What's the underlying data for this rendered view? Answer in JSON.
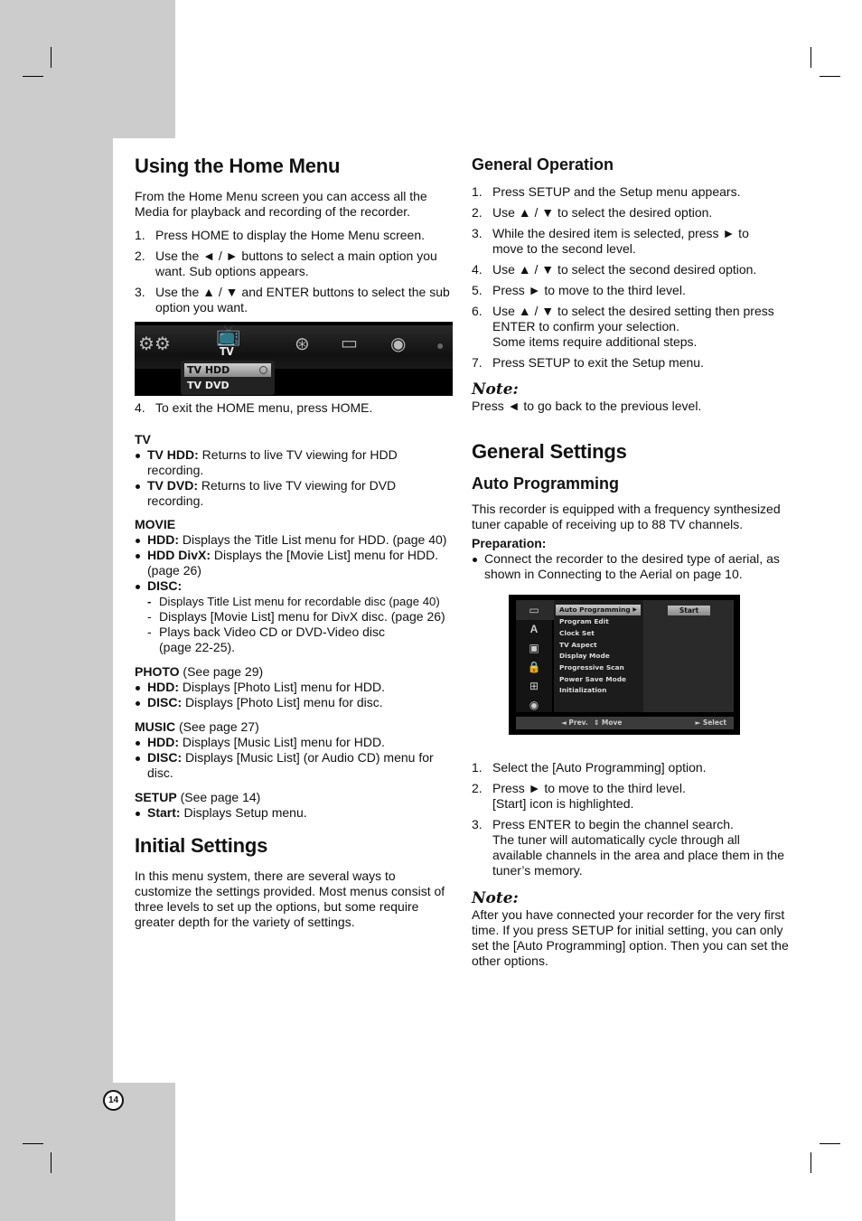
{
  "page_number": "14",
  "left_column": {
    "home_menu": {
      "title": "Using the Home Menu",
      "intro": "From the Home Menu screen you can access all the Media for playback and recording of the recorder.",
      "steps": [
        {
          "num": "1.",
          "text": "Press HOME to display the Home Menu screen."
        },
        {
          "num": "2.",
          "text": "Use the ◄ / ► buttons to select a main option you want. Sub options appears."
        },
        {
          "num": "3.",
          "text": "Use the ▲ / ▼ and ENTER buttons to select the sub option you want."
        }
      ],
      "screen": {
        "icons": [
          "setup-gears-icon",
          "tv-icon",
          "movie-reel-icon",
          "photo-icon",
          "music-icon",
          "clock-icon"
        ],
        "selected_label": "TV",
        "sub_items": [
          {
            "label": "TV HDD",
            "selected": true
          },
          {
            "label": "TV DVD",
            "selected": false
          }
        ]
      },
      "step4": {
        "num": "4.",
        "text": "To exit the HOME menu, press HOME."
      }
    },
    "categories": {
      "tv": {
        "heading": "TV",
        "items": [
          {
            "term": "TV HDD:",
            "text": " Returns to live TV viewing for HDD recording."
          },
          {
            "term": "TV DVD:",
            "text": " Returns to live TV viewing for DVD recording."
          }
        ]
      },
      "movie": {
        "heading": "MOVIE",
        "items": [
          {
            "term": "HDD:",
            "text": " Displays the Title List menu for HDD. (page 40)"
          },
          {
            "term": "HDD DivX:",
            "text": " Displays the [Movie List] menu for HDD. (page 26)"
          },
          {
            "term": "DISC:",
            "text": ""
          }
        ],
        "disc_sub": [
          "Displays Title List menu for recordable disc (page 40)",
          "Displays [Movie List] menu for DivX disc. (page 26)",
          "Plays back Video CD or DVD-Video disc (page 22-25)."
        ]
      },
      "photo": {
        "heading": "PHOTO",
        "ref": " (See page 29)",
        "items": [
          {
            "term": "HDD:",
            "text": " Displays [Photo List] menu for HDD."
          },
          {
            "term": "DISC:",
            "text": " Displays [Photo List] menu for disc."
          }
        ]
      },
      "music": {
        "heading": "MUSIC",
        "ref": " (See page 27)",
        "items": [
          {
            "term": "HDD:",
            "text": " Displays [Music List] menu for HDD."
          },
          {
            "term": "DISC:",
            "text": " Displays [Music List] (or Audio CD) menu for disc."
          }
        ]
      },
      "setup": {
        "heading": "SETUP",
        "ref": " (See page 14)",
        "items": [
          {
            "term": "Start:",
            "text": " Displays Setup menu."
          }
        ]
      }
    },
    "initial_settings": {
      "title": "Initial Settings",
      "text": "In this menu system, there are several ways to customize the settings provided. Most menus consist of three levels to set up the options, but some require greater depth for the variety of settings."
    }
  },
  "right_column": {
    "general_operation": {
      "title": "General Operation",
      "steps": [
        {
          "num": "1.",
          "text": "Press SETUP and the Setup menu appears."
        },
        {
          "num": "2.",
          "text": "Use ▲ / ▼ to select the desired option."
        },
        {
          "num": "3.",
          "text": "While the desired item is selected, press ► to move to the second level."
        },
        {
          "num": "4.",
          "text": "Use ▲ / ▼ to select the second desired option."
        },
        {
          "num": "5.",
          "text": "Press ► to move to the third level."
        },
        {
          "num": "6.",
          "text": "Use ▲ / ▼ to select the desired setting then press ENTER to confirm your selection.",
          "extra": "Some items require additional steps."
        },
        {
          "num": "7.",
          "text": "Press SETUP to exit the Setup menu."
        }
      ],
      "note_heading": "Note:",
      "note_text": "Press ◄  to go back to the previous level."
    },
    "general_settings": {
      "title": "General Settings",
      "subtitle": "Auto Programming",
      "intro": "This recorder is equipped with a frequency synthesized tuner capable of receiving up to 88 TV channels.",
      "prep_heading": "Preparation:",
      "prep_items": [
        "Connect the recorder to the desired type of aerial, as shown in Connecting to the Aerial on page 10."
      ],
      "screen": {
        "side_icons": [
          "tv-setup-icon",
          "language-icon",
          "audio-icon",
          "lock-icon",
          "recording-icon",
          "disc-icon"
        ],
        "menu_items": [
          {
            "label": "Auto Programming",
            "selected": true
          },
          {
            "label": "Program Edit",
            "selected": false
          },
          {
            "label": "Clock Set",
            "selected": false
          },
          {
            "label": "TV Aspect",
            "selected": false
          },
          {
            "label": "Display Mode",
            "selected": false
          },
          {
            "label": "Progressive Scan",
            "selected": false
          },
          {
            "label": "Power Save Mode",
            "selected": false
          },
          {
            "label": "Initialization",
            "selected": false
          }
        ],
        "option_button": "Start",
        "footer_prev": "◄ Prev.",
        "footer_move": "⇕ Move",
        "footer_select": "► Select"
      },
      "steps": [
        {
          "num": "1.",
          "text": "Select the [Auto Programming] option."
        },
        {
          "num": "2.",
          "text": "Press ► to move to the third level.",
          "extra": "[Start] icon is highlighted."
        },
        {
          "num": "3.",
          "text": "Press ENTER to begin the channel search.",
          "extra": "The tuner will automatically cycle through all available channels in the area and place them in the tuner’s memory."
        }
      ],
      "note_heading": "Note:",
      "note_text": "After you have connected your recorder for the very first time. If you press SETUP for initial setting, you can only set the [Auto Programming] option. Then you can set the other options."
    }
  }
}
